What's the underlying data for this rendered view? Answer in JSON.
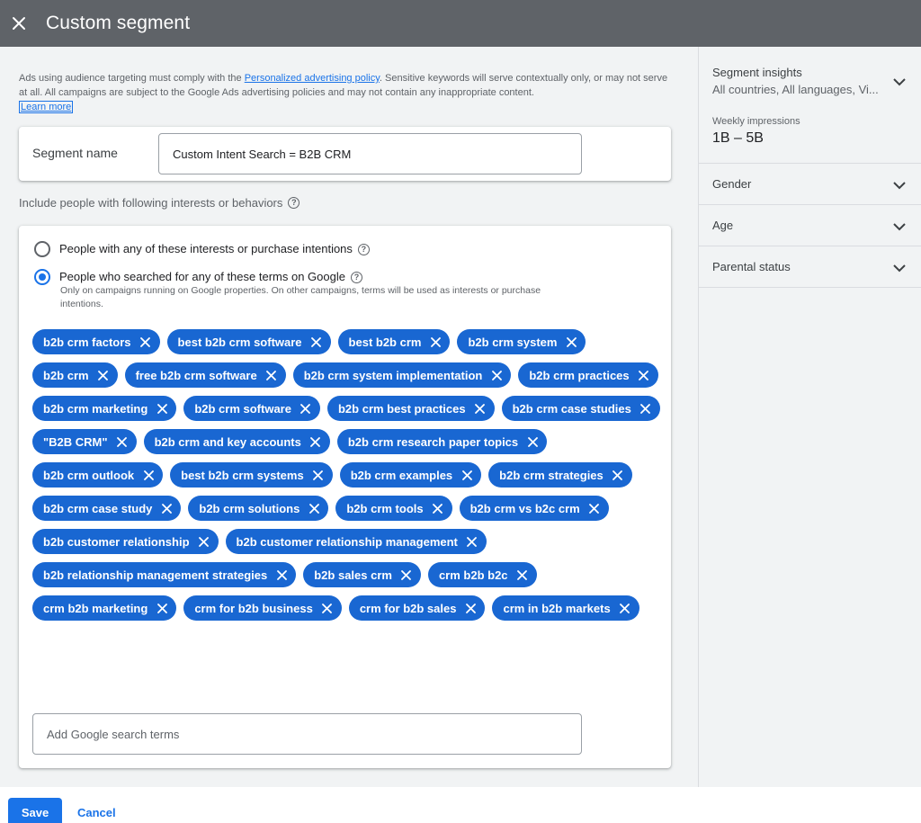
{
  "header": {
    "title": "Custom segment",
    "close_icon": "close-icon"
  },
  "notice": {
    "text_before_link": "Ads using audience targeting must comply with the ",
    "policy_link": "Personalized advertising policy",
    "text_after_link": ". Sensitive keywords will serve contextually only, or may not serve at all. All campaigns are subject to the Google Ads advertising policies and may not contain any inappropriate content.",
    "learn_more": "Learn more"
  },
  "segment": {
    "name_label": "Segment name",
    "name_value": "Custom Intent Search = B2B CRM"
  },
  "include": {
    "label": "Include people with following interests or behaviors",
    "option_interests": "People with any of these interests or purchase intentions",
    "option_searched": "People who searched for any of these terms on Google",
    "option_searched_note": "Only on campaigns running on Google properties. On other campaigns, terms will be used as interests or purchase intentions.",
    "selected_option": "searched"
  },
  "terms": [
    "b2b crm factors",
    "best b2b crm software",
    "best b2b crm",
    "b2b crm system",
    "b2b crm",
    "free b2b crm software",
    "b2b crm system implementation",
    "b2b crm practices",
    "b2b crm marketing",
    "b2b crm software",
    "b2b crm best practices",
    "b2b crm case studies",
    "\"B2B CRM\"",
    "b2b crm and key accounts",
    "b2b crm research paper topics",
    "b2b crm outlook",
    "best b2b crm systems",
    "b2b crm examples",
    "b2b crm strategies",
    "b2b crm case study",
    "b2b crm solutions",
    "b2b crm tools",
    "b2b crm vs b2c crm",
    "b2b customer relationship",
    "b2b customer relationship management",
    "b2b relationship management strategies",
    "b2b sales crm",
    "crm b2b b2c",
    "crm b2b marketing",
    "crm for b2b business",
    "crm for b2b sales",
    "crm in b2b markets"
  ],
  "add_terms_placeholder": "Add Google search terms",
  "sidebar": {
    "insights_title": "Segment insights",
    "insights_sub": "All countries, All languages, Vi...",
    "weekly_label": "Weekly impressions",
    "weekly_value": "1B – 5B",
    "gender": "Gender",
    "age": "Age",
    "parental": "Parental status"
  },
  "footer": {
    "save": "Save",
    "cancel": "Cancel"
  },
  "colors": {
    "header_bg": "#5f6368",
    "chip_bg": "#1967d2",
    "accent": "#1a73e8"
  }
}
